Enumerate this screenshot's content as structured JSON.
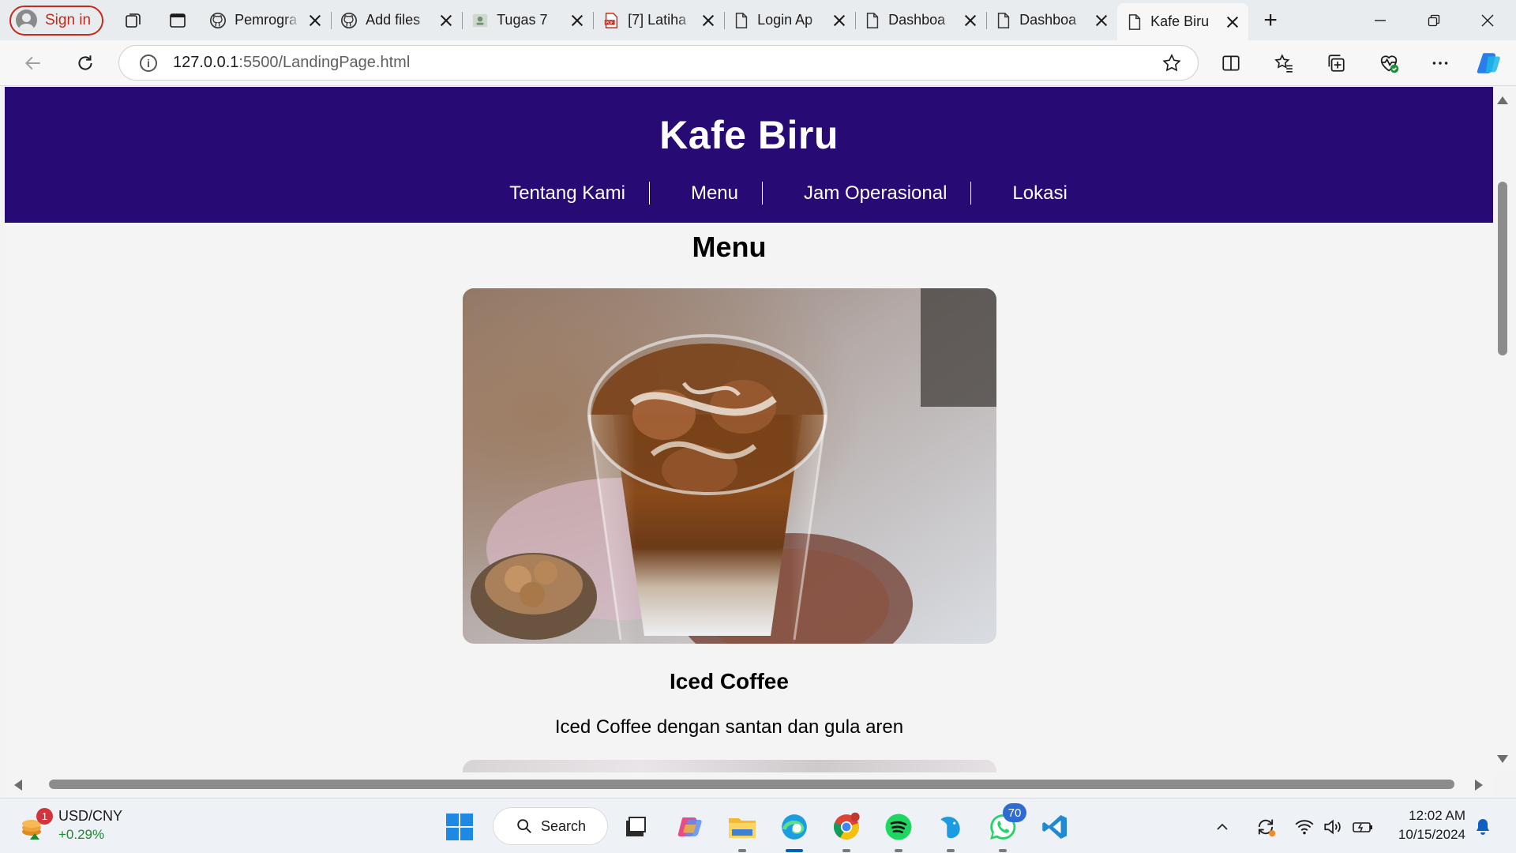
{
  "browser": {
    "sign_in_label": "Sign in",
    "tabs": [
      {
        "title": "Pemrogra",
        "icon": "github-icon"
      },
      {
        "title": "Add files",
        "icon": "github-icon"
      },
      {
        "title": "Tugas 7",
        "icon": "classroom-icon"
      },
      {
        "title": "[7] Latiha",
        "icon": "pdf-icon"
      },
      {
        "title": "Login Ap",
        "icon": "page-icon"
      },
      {
        "title": "Dashboa",
        "icon": "page-icon"
      },
      {
        "title": "Dashboa",
        "icon": "page-icon"
      },
      {
        "title": "Kafe Biru",
        "icon": "page-icon",
        "active": true
      }
    ],
    "url_host": "127.0.0.1",
    "url_rest": ":5500/LandingPage.html"
  },
  "site": {
    "title": "Kafe Biru",
    "nav": [
      "Tentang Kami",
      "Menu",
      "Jam Operasional",
      "Lokasi"
    ],
    "section_title": "Menu",
    "item": {
      "name": "Iced Coffee",
      "description": "Iced Coffee dengan santan dan gula aren"
    },
    "header_color": "#280a75"
  },
  "taskbar": {
    "widget_title": "USD/CNY",
    "widget_change": "+0.29%",
    "widget_badge": "1",
    "search_label": "Search",
    "whatsapp_badge": "70",
    "time": "12:02 AM",
    "date": "10/15/2024"
  }
}
